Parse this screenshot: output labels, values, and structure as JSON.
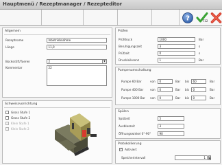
{
  "header": {
    "title": "Hauptmenü / Rezeptmanager / Rezepteditor"
  },
  "toolbar": {
    "help_icon": "help-circle-icon",
    "ok_icon": "checkmark-icon",
    "ok_caption": "F12",
    "close_icon": "close-x-icon"
  },
  "allgemein": {
    "title": "Allgemein",
    "rezeptname_label": "Rezeptname",
    "rezeptname_value": "Inbetriebnahme",
    "laenge_label": "Länge",
    "laenge_value": "11,0",
    "bocksstift_label": "Bocksstift/Tueren",
    "bocksstift_value": "2",
    "kommentar_label": "Kommentar",
    "kommentar_value": "22"
  },
  "schweiss": {
    "title": "Schweissvorrichtung",
    "items": [
      {
        "label": "Gross Stufe 1",
        "disabled": false
      },
      {
        "label": "Gross Stufe 2",
        "disabled": false
      },
      {
        "label": "Klein Stufe 1",
        "disabled": true
      },
      {
        "label": "Klein Stufe 2",
        "disabled": true
      }
    ]
  },
  "pruefen": {
    "title": "Prüfen",
    "rows": [
      {
        "label": "Prüfdruck",
        "value": "1000",
        "unit": "Bar"
      },
      {
        "label": "Beruhigungszeit",
        "value": "3",
        "unit": "s"
      },
      {
        "label": "Prüfzeit",
        "value": "0",
        "unit": "s"
      },
      {
        "label": "Druckleilerenz",
        "value": "1",
        "unit": "Bar"
      }
    ]
  },
  "pumpen": {
    "title": "Pumpenumschaltung",
    "von": "von",
    "bis": "bis",
    "unit": "Bar",
    "rows": [
      {
        "label": "Pumpe 60 Bar",
        "from": "0",
        "to": "60"
      },
      {
        "label": "Pumpe 400 Bar",
        "from": "0",
        "to": "0"
      },
      {
        "label": "Pumpe 1000 Bar",
        "from": "0",
        "to": "0"
      }
    ]
  },
  "spulen": {
    "title": "Spülen",
    "rows": [
      {
        "label": "Spülzeit",
        "value": "5"
      },
      {
        "label": "Ausblaszeit",
        "value": "3"
      },
      {
        "label": "Öffnungswinkel 0°-90°",
        "value": "90"
      }
    ]
  },
  "protokoll": {
    "title": "Protokollierung",
    "aktiviert_label": "Aktiviert",
    "aktiviert_checked": true,
    "speicher_label": "Speicherintervall",
    "speicher_value": "1"
  }
}
